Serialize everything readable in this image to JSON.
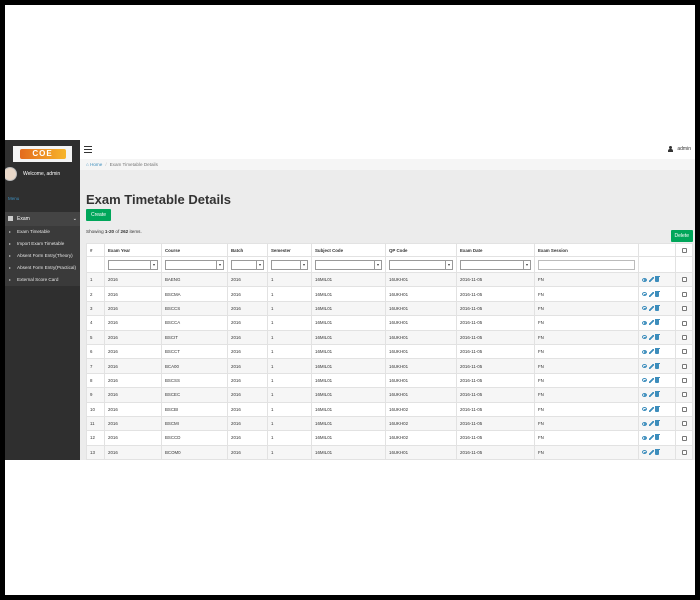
{
  "logo_text": "COE",
  "user": {
    "welcome": "Welcome, admin",
    "name": "admin"
  },
  "sidebar": {
    "menu_label": "Menu",
    "group_label": "Exam",
    "items": [
      {
        "label": "Exam Timetable"
      },
      {
        "label": "Import Exam Timetable"
      },
      {
        "label": "Absent Form Entry(Theory)"
      },
      {
        "label": "Absent Form Entry(Practical)"
      },
      {
        "label": "External Score Card"
      }
    ]
  },
  "breadcrumb": {
    "home": "Home",
    "current": "Exam Timetable Details"
  },
  "page": {
    "title": "Exam Timetable Details",
    "create_label": "Create",
    "delete_label": "Delete",
    "showing_prefix": "Showing",
    "showing_range": "1-20",
    "showing_of": "of",
    "showing_total": "262",
    "showing_suffix": "items."
  },
  "table": {
    "columns": [
      "#",
      "Exam Year",
      "Course",
      "Batch",
      "Semester",
      "Subject Code",
      "QP Code",
      "Exam Date",
      "Exam Session"
    ],
    "rows": [
      {
        "num": "1",
        "year": "2016",
        "course": "BAENG",
        "batch": "2016",
        "semester": "1",
        "subject": "16MIL01",
        "qp": "16UKH01",
        "date": "2016-11-05",
        "session": "FN"
      },
      {
        "num": "2",
        "year": "2016",
        "course": "BSCMA",
        "batch": "2016",
        "semester": "1",
        "subject": "16MIL01",
        "qp": "16UKH01",
        "date": "2016-11-05",
        "session": "FN"
      },
      {
        "num": "3",
        "year": "2016",
        "course": "BSCCS",
        "batch": "2016",
        "semester": "1",
        "subject": "16MIL01",
        "qp": "16UKH01",
        "date": "2016-11-05",
        "session": "FN"
      },
      {
        "num": "4",
        "year": "2016",
        "course": "BSCCA",
        "batch": "2016",
        "semester": "1",
        "subject": "16MIL01",
        "qp": "16UKH01",
        "date": "2016-11-05",
        "session": "FN"
      },
      {
        "num": "5",
        "year": "2016",
        "course": "BSCIT",
        "batch": "2016",
        "semester": "1",
        "subject": "16MIL01",
        "qp": "16UKH01",
        "date": "2016-11-05",
        "session": "FN"
      },
      {
        "num": "6",
        "year": "2016",
        "course": "BSCCT",
        "batch": "2016",
        "semester": "1",
        "subject": "16MIL01",
        "qp": "16UKH01",
        "date": "2016-11-05",
        "session": "FN"
      },
      {
        "num": "7",
        "year": "2016",
        "course": "BCA00",
        "batch": "2016",
        "semester": "1",
        "subject": "16MIL01",
        "qp": "16UKH01",
        "date": "2016-11-05",
        "session": "FN"
      },
      {
        "num": "8",
        "year": "2016",
        "course": "BSCSS",
        "batch": "2016",
        "semester": "1",
        "subject": "16MIL01",
        "qp": "16UKH01",
        "date": "2016-11-05",
        "session": "FN"
      },
      {
        "num": "9",
        "year": "2016",
        "course": "BSCEC",
        "batch": "2016",
        "semester": "1",
        "subject": "16MIL01",
        "qp": "16UKH01",
        "date": "2016-11-05",
        "session": "FN"
      },
      {
        "num": "10",
        "year": "2016",
        "course": "BSCBI",
        "batch": "2016",
        "semester": "1",
        "subject": "16MIL01",
        "qp": "16UKH02",
        "date": "2016-11-05",
        "session": "FN"
      },
      {
        "num": "11",
        "year": "2016",
        "course": "BSCMI",
        "batch": "2016",
        "semester": "1",
        "subject": "16MIL01",
        "qp": "16UKH02",
        "date": "2016-11-05",
        "session": "FN"
      },
      {
        "num": "12",
        "year": "2016",
        "course": "BSCCD",
        "batch": "2016",
        "semester": "1",
        "subject": "16MIL01",
        "qp": "16UKH02",
        "date": "2016-11-05",
        "session": "FN"
      },
      {
        "num": "13",
        "year": "2016",
        "course": "BCOM0",
        "batch": "2016",
        "semester": "1",
        "subject": "16MIL01",
        "qp": "16UKH01",
        "date": "2016-11-05",
        "session": "FN"
      }
    ]
  },
  "icons": {
    "view": "eye-icon",
    "edit": "pencil-icon",
    "delete": "trash-icon",
    "menu": "hamburger-icon",
    "user": "user-icon"
  },
  "colors": {
    "sidebar_bg": "#2f2f2f",
    "accent_green": "#00a65a",
    "link_blue": "#3c8dbc"
  }
}
